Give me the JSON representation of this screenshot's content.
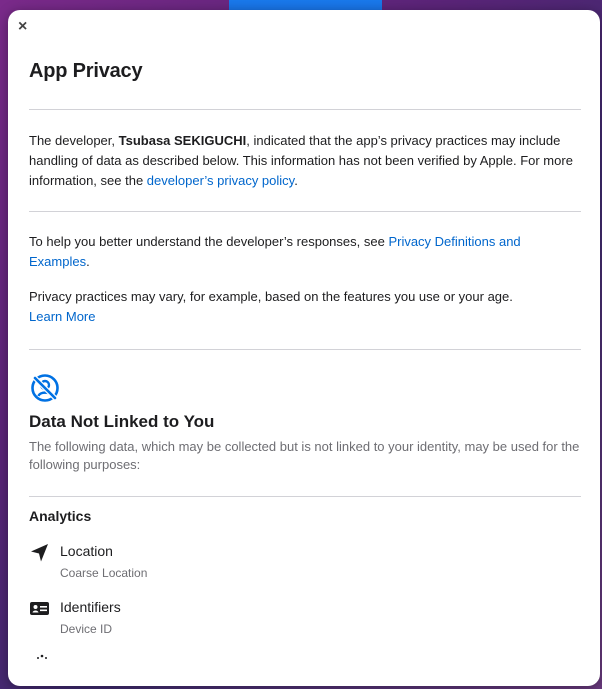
{
  "dialog": {
    "close_label": "×",
    "title": "App Privacy"
  },
  "intro": {
    "text_before_dev": "The developer, ",
    "developer_name": "Tsubasa SEKIGUCHI",
    "text_after_dev": ", indicated that the app’s privacy practices may include handling of data as described below. This information has not been verified by Apple. For more information, see the ",
    "policy_link": "developer’s privacy policy",
    "text_end": "."
  },
  "help": {
    "text_before_link": "To help you better understand the developer’s responses, see ",
    "definitions_link": "Privacy Definitions and Examples",
    "text_end": "."
  },
  "practices": {
    "text": "Privacy practices may vary, for example, based on the features you use or your age.",
    "learn_more_link": "Learn More"
  },
  "section": {
    "icon": "not-linked-icon",
    "title": "Data Not Linked to You",
    "description": "The following data, which may be collected but is not linked to your identity, may be used for the following purposes:",
    "purpose": "Analytics",
    "items": [
      {
        "icon": "location-arrow-icon",
        "name": "Location",
        "detail": "Coarse Location"
      },
      {
        "icon": "id-card-icon",
        "name": "Identifiers",
        "detail": "Device ID"
      }
    ]
  },
  "colors": {
    "link": "#0066cc",
    "section_icon": "#0071e3",
    "app_icon": "#1a78ec"
  }
}
